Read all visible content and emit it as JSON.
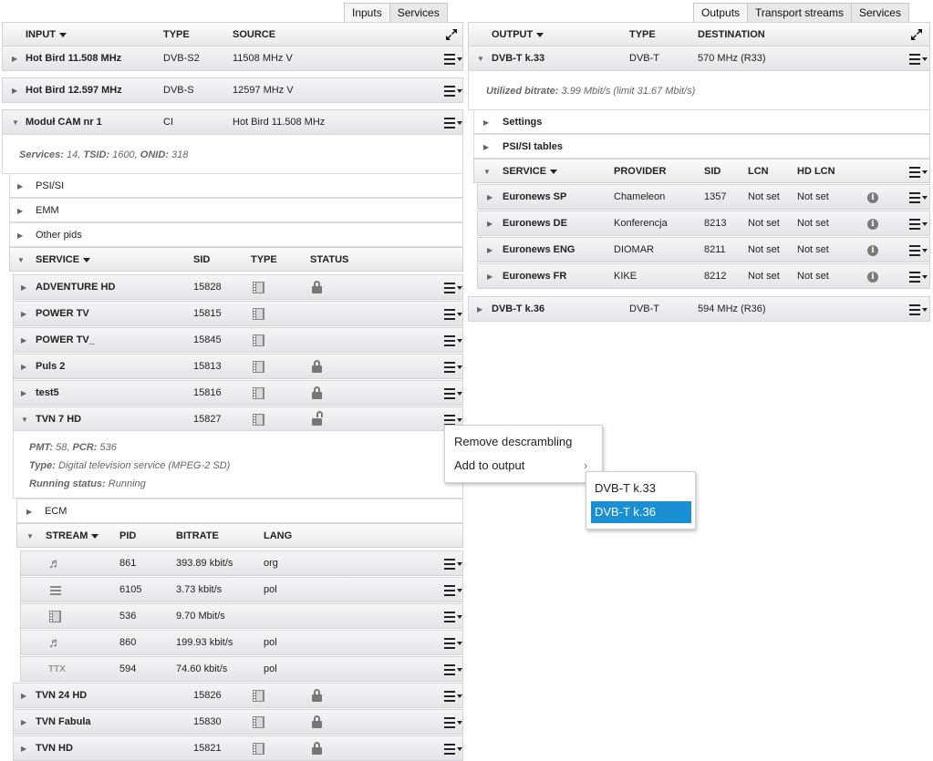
{
  "left": {
    "tabs": [
      "Inputs",
      "Services"
    ],
    "header": {
      "input": "INPUT",
      "type": "TYPE",
      "source": "SOURCE"
    },
    "inputs": [
      {
        "name": "Hot Bird 11.508 MHz",
        "type": "DVB-S2",
        "source": "11508 MHz V"
      },
      {
        "name": "Hot Bird 12.597 MHz",
        "type": "DVB-S",
        "source": "12597 MHz V"
      },
      {
        "name": "Moduł CAM nr 1",
        "type": "CI",
        "source": "Hot Bird 11.508 MHz"
      }
    ],
    "cam_detail": {
      "label": "Services:",
      "text": "14, TSID: 1600, ONID: 318",
      "tsid_label": "TSID:",
      "onid_label": "ONID:",
      "services": "14",
      "tsid": "1600",
      "onid": "318"
    },
    "sections": [
      "PSI/SI",
      "EMM",
      "Other pids"
    ],
    "service_header": {
      "service": "SERVICE",
      "sid": "SID",
      "type": "TYPE",
      "status": "STATUS"
    },
    "services": [
      {
        "name": "ADVENTURE HD",
        "sid": "15828",
        "locked": true
      },
      {
        "name": "POWER TV",
        "sid": "15815",
        "locked": false
      },
      {
        "name": "POWER TV_",
        "sid": "15845",
        "locked": false
      },
      {
        "name": "Puls 2",
        "sid": "15813",
        "locked": true
      },
      {
        "name": "test5",
        "sid": "15816",
        "locked": true
      },
      {
        "name": "TVN 7 HD",
        "sid": "15827",
        "locked": "open"
      }
    ],
    "tvn_detail": {
      "pmt_label": "PMT:",
      "pmt": "58,",
      "pcr_label": "PCR:",
      "pcr": "536",
      "type_label": "Type:",
      "type": "Digital television service (MPEG-2 SD)",
      "running_label": "Running status:",
      "running": "Running"
    },
    "ecm": "ECM",
    "stream_header": {
      "stream": "STREAM",
      "pid": "PID",
      "bitrate": "BITRATE",
      "lang": "LANG"
    },
    "streams": [
      {
        "icon": "music-note-icon",
        "pid": "861",
        "bitrate": "393.89 kbit/s",
        "lang": "org"
      },
      {
        "icon": "subtitle-lines-icon",
        "pid": "6105",
        "bitrate": "3.73 kbit/s",
        "lang": "pol"
      },
      {
        "icon": "film-icon",
        "pid": "536",
        "bitrate": "9.70 Mbit/s",
        "lang": ""
      },
      {
        "icon": "music-note-icon",
        "pid": "860",
        "bitrate": "199.93 kbit/s",
        "lang": "pol"
      },
      {
        "icon": "teletext-icon",
        "ttx": "TTX",
        "pid": "594",
        "bitrate": "74.60 kbit/s",
        "lang": "pol"
      }
    ],
    "services_more": [
      {
        "name": "TVN 24 HD",
        "sid": "15826"
      },
      {
        "name": "TVN Fabula",
        "sid": "15830"
      },
      {
        "name": "TVN HD",
        "sid": "15821"
      }
    ]
  },
  "right": {
    "tabs": [
      "Outputs",
      "Transport streams",
      "Services"
    ],
    "header": {
      "output": "OUTPUT",
      "type": "TYPE",
      "destination": "DESTINATION"
    },
    "outputs": [
      {
        "name": "DVB-T k.33",
        "type": "DVB-T",
        "destination": "570 MHz (R33)"
      },
      {
        "name": "DVB-T k.36",
        "type": "DVB-T",
        "destination": "594 MHz (R36)"
      }
    ],
    "bitrate_label": "Utilized bitrate:",
    "bitrate_text": "3.99 Mbit/s (limit 31.67 Mbit/s)",
    "sections": [
      "Settings",
      "PSI/SI tables"
    ],
    "service_header": {
      "service": "SERVICE",
      "provider": "PROVIDER",
      "sid": "SID",
      "lcn": "LCN",
      "hdlcn": "HD LCN"
    },
    "services": [
      {
        "name": "Euronews SP",
        "provider": "Chameleon",
        "sid": "1357",
        "lcn": "Not set",
        "hdlcn": "Not set"
      },
      {
        "name": "Euronews DE",
        "provider": "Konferencja",
        "sid": "8213",
        "lcn": "Not set",
        "hdlcn": "Not set"
      },
      {
        "name": "Euronews ENG",
        "provider": "DIOMAR",
        "sid": "8211",
        "lcn": "Not set",
        "hdlcn": "Not set"
      },
      {
        "name": "Euronews FR",
        "provider": "KIKE",
        "sid": "8212",
        "lcn": "Not set",
        "hdlcn": "Not set"
      }
    ]
  },
  "context_menu": {
    "items": [
      "Remove descrambling",
      "Add to output"
    ]
  },
  "submenu": {
    "items": [
      "DVB-T k.33",
      "DVB-T k.36"
    ],
    "selected_index": 1
  },
  "colors": {
    "accent": "#1a8fd4",
    "row_border": "#d2d4d8"
  }
}
